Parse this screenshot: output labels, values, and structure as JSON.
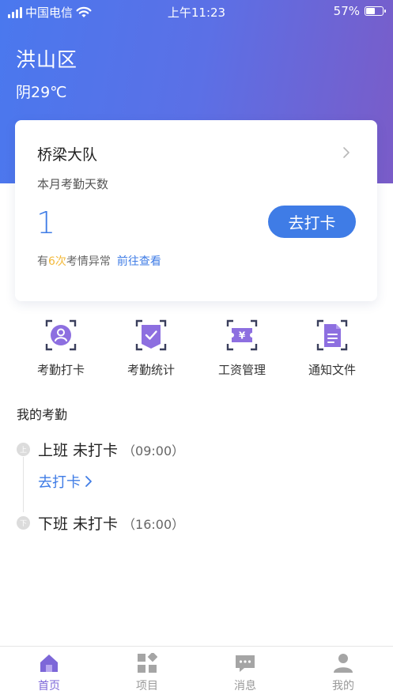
{
  "status_bar": {
    "carrier": "中国电信",
    "time": "上午11:23",
    "battery": "57%"
  },
  "header": {
    "district": "洪山区",
    "weather": "阴29℃"
  },
  "card": {
    "team_name": "桥梁大队",
    "month_label": "本月考勤天数",
    "day_count": "1",
    "punch_button": "去打卡",
    "abnormal_prefix": "有",
    "abnormal_count": "6次",
    "abnormal_suffix": "考情异常",
    "view_link": "前往查看"
  },
  "quick_actions": [
    {
      "label": "考勤打卡",
      "icon": "user-badge-icon"
    },
    {
      "label": "考勤统计",
      "icon": "checklist-icon"
    },
    {
      "label": "工资管理",
      "icon": "yuan-ticket-icon"
    },
    {
      "label": "通知文件",
      "icon": "document-icon"
    }
  ],
  "attendance": {
    "title": "我的考勤",
    "on_duty": {
      "badge": "上",
      "label": "上班 未打卡",
      "time": "（09:00）"
    },
    "punch_link": "去打卡",
    "off_duty": {
      "badge": "下",
      "label": "下班 未打卡",
      "time": "（16:00）"
    }
  },
  "tabs": [
    {
      "label": "首页",
      "icon": "home-icon",
      "active": true
    },
    {
      "label": "项目",
      "icon": "grid-icon",
      "active": false
    },
    {
      "label": "消息",
      "icon": "message-icon",
      "active": false
    },
    {
      "label": "我的",
      "icon": "person-icon",
      "active": false
    }
  ],
  "colors": {
    "primary": "#3f7ce6",
    "accent_purple": "#7d67d8",
    "highlight": "#f3b93a"
  }
}
